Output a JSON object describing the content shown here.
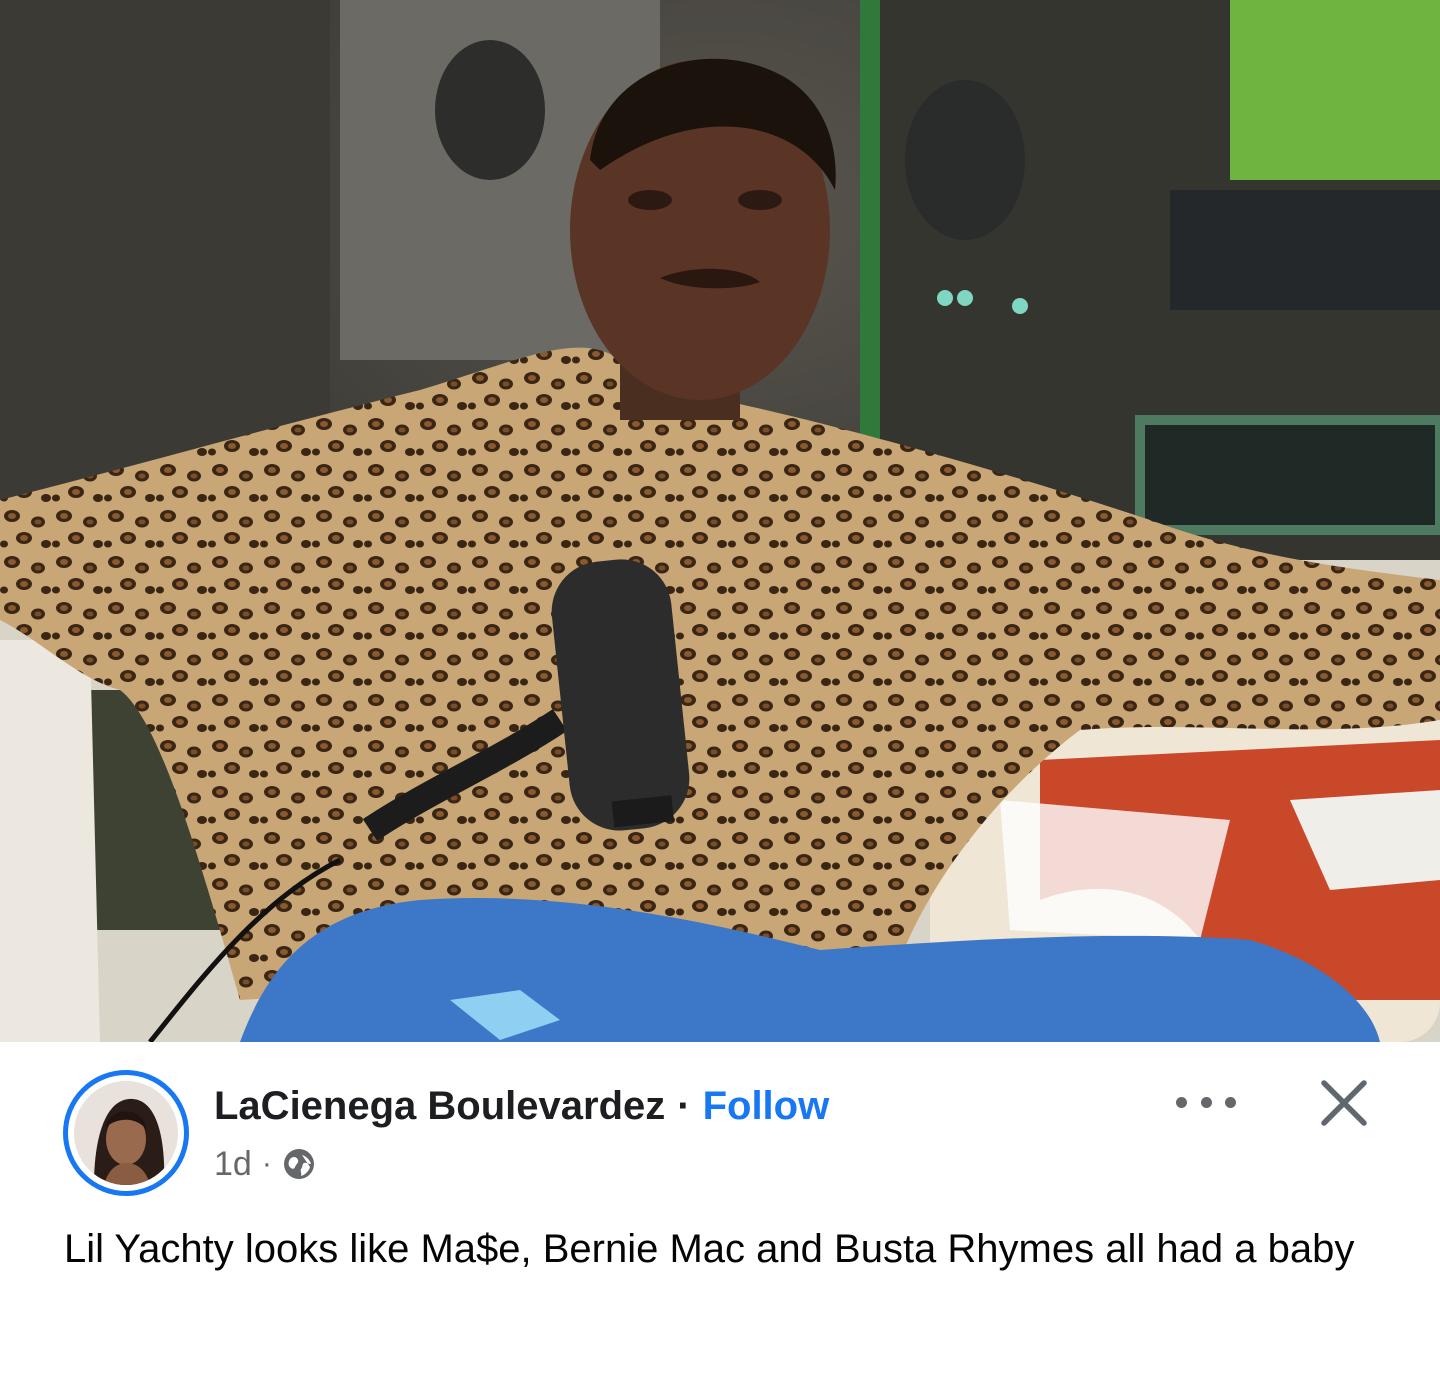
{
  "post": {
    "author": "LaCienega Boulevardez",
    "separator": "·",
    "follow_label": "Follow",
    "timestamp": "1d",
    "meta_separator": "·",
    "audience_icon": "globe-icon",
    "more_icon": "more-options-icon",
    "close_icon": "close-icon",
    "caption": "Lil Yachty looks like Ma$e, Bernie Mac and Busta Rhymes all had a baby"
  },
  "colors": {
    "accent": "#1877f2",
    "text_primary": "#050505",
    "text_secondary": "#65676b"
  }
}
